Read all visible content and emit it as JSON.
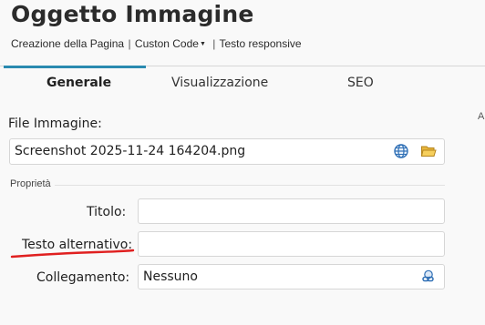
{
  "header": {
    "title": "Oggetto Immagine",
    "breadcrumb": {
      "item1": "Creazione della Pagina",
      "separator1": "|",
      "item2": "Custon Code",
      "separator2": "|",
      "item3": "Testo responsive"
    }
  },
  "tabs": [
    {
      "label": "Generale",
      "active": true
    },
    {
      "label": "Visualizzazione",
      "active": false
    },
    {
      "label": "SEO",
      "active": false
    }
  ],
  "right_edge_text": "A",
  "form": {
    "file": {
      "label": "File Immagine:",
      "value": "Screenshot 2025-11-24 164204.png",
      "icons": [
        "globe-icon",
        "folder-open-icon"
      ]
    },
    "section_title": "Proprietà",
    "title_field": {
      "label": "Titolo:",
      "value": ""
    },
    "alt_field": {
      "label": "Testo alternativo:",
      "value": ""
    },
    "link_field": {
      "label": "Collegamento:",
      "value": "Nessuno",
      "icon": "link-icon"
    }
  },
  "colors": {
    "accent": "#2a8ab0",
    "annotation": "#e02020",
    "background": "#f9f9f9"
  }
}
